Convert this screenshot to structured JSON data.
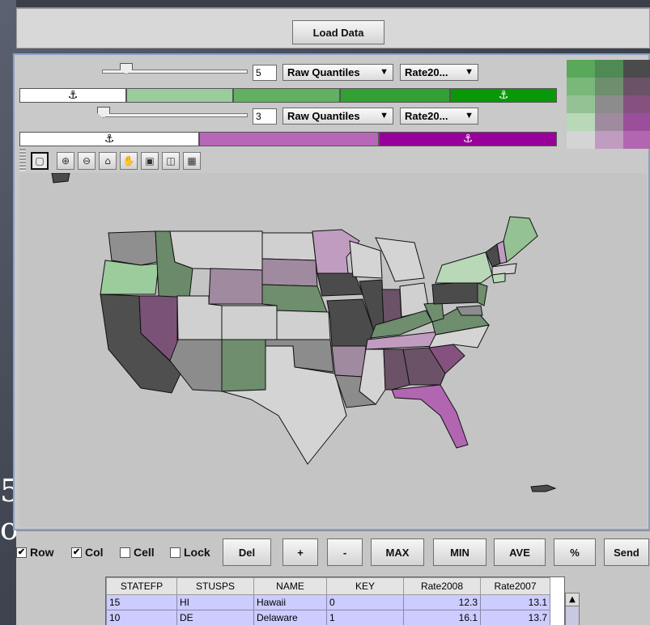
{
  "toolbar": {
    "load_button": "Load Data"
  },
  "row1": {
    "classes": "5",
    "method": "Raw Quantiles",
    "variable": "Rate20...",
    "anchor_glyph": "⚓",
    "colors": [
      "#ffffff",
      "#98c898",
      "#5ab05a",
      "#2ea02e",
      "#0a9b0a"
    ]
  },
  "row2": {
    "classes": "3",
    "method": "Raw Quantiles",
    "variable": "Rate20...",
    "anchor_glyph": "⚓",
    "colors": [
      "#ffffff",
      "#b866b8",
      "#990099"
    ]
  },
  "legend_colors": [
    "#5aa85a",
    "#4f8a55",
    "#4b4b4b",
    "#7ab87a",
    "#6e8e6e",
    "#6b5266",
    "#94c294",
    "#8c8c8c",
    "#85527f",
    "#b8d8b8",
    "#a08aa0",
    "#9b4f9b",
    "#d4d4d4",
    "#c09cc0",
    "#b266b2"
  ],
  "map_tools": [
    "select-icon",
    "zoom-in-icon",
    "zoom-out-icon",
    "home-icon",
    "pan-icon",
    "full-extent-icon",
    "identify-icon",
    "grid-icon"
  ],
  "bottom": {
    "row_label": "Row",
    "col_label": "Col",
    "cell_label": "Cell",
    "lock_label": "Lock",
    "buttons": [
      "Del",
      "+",
      "-",
      "MAX",
      "MIN",
      "AVE",
      "%",
      "Send"
    ]
  },
  "table": {
    "headers": [
      "STATEFP",
      "STUSPS",
      "NAME",
      "KEY",
      "Rate2008",
      "Rate2007"
    ],
    "rows": [
      [
        "15",
        "HI",
        "Hawaii",
        "0",
        "12.3",
        "13.1"
      ],
      [
        "10",
        "DE",
        "Delaware",
        "1",
        "16.1",
        "13.7"
      ]
    ]
  },
  "side_fragments": {
    "top": "5",
    "bottom": "o"
  }
}
